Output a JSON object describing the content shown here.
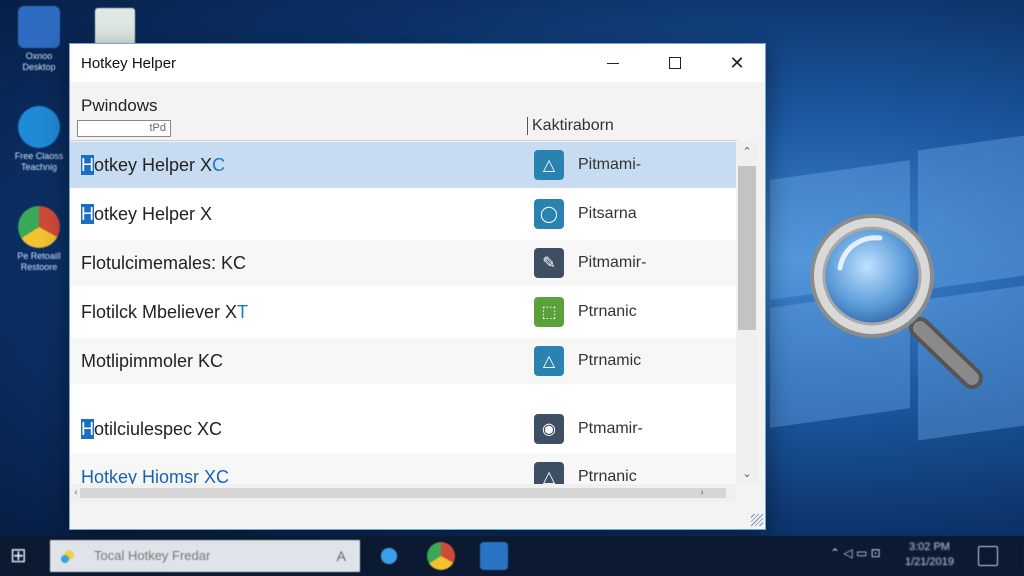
{
  "desktop": {
    "icons": [
      {
        "label": "Oxnoo Desktop",
        "color": "#2d6cc0"
      },
      {
        "label": "Free Claoss Teachnig",
        "color": "#1f8ad6"
      },
      {
        "label": "Pe Retoaill Restoore",
        "color": "#d04a3a"
      }
    ]
  },
  "window": {
    "title": "Hotkey Helper",
    "minimize_label": "—",
    "maximize_label": "□",
    "close_label": "✕",
    "section_label": "Pwindows",
    "filter_value": "tPd",
    "column_header": "Kaktiraborn",
    "rows": [
      {
        "name_highlight": "H",
        "name_rest": "otkey Helper X",
        "name_tail": "C",
        "tag_icon": "△",
        "tag_color": "#2a82b0",
        "type": "Pitmami-",
        "selected": true
      },
      {
        "name_highlight": "H",
        "name_rest": "otkey Helper X",
        "name_tail": "",
        "tag_icon": "◯",
        "tag_color": "#2a82b0",
        "type": "Pitsarna",
        "selected": false
      },
      {
        "name_highlight": "",
        "name_rest": "Flotulcimemales: KC",
        "name_tail": "",
        "tag_icon": "✎",
        "tag_color": "#3f4f63",
        "type": "Pitmamir-",
        "selected": false
      },
      {
        "name_highlight": "",
        "name_rest": "Flotilck Mbeliever X",
        "name_tail": "T",
        "tag_icon": "⬚",
        "tag_color": "#5aa13a",
        "type": "Ptrnanic",
        "selected": false
      },
      {
        "name_highlight": "",
        "name_rest": "Motlipimmoler KC",
        "name_tail": "",
        "tag_icon": "△",
        "tag_color": "#2a82b0",
        "type": "Ptrnamic",
        "selected": false
      },
      {
        "name_highlight": "H",
        "name_rest": "otilciulespec XC",
        "name_tail": "",
        "tag_icon": "◉",
        "tag_color": "#3f4f63",
        "type": "Ptmamir-",
        "selected": false
      },
      {
        "name_highlight": "",
        "name_rest": "Hotkey Hiomsr XC",
        "name_tail": "",
        "tag_icon": "△",
        "tag_color": "#3f4f63",
        "type": "Ptrnanic",
        "selected": false
      }
    ]
  },
  "taskbar": {
    "start_icon": "⊞",
    "search_placeholder": "Tocal Hotkey Fredar",
    "mic_icon": "A",
    "tray_icons": "⌃  ◁  ▭  ⊡",
    "clock_time": "3:02 PM",
    "clock_date": "1/21/2019"
  }
}
